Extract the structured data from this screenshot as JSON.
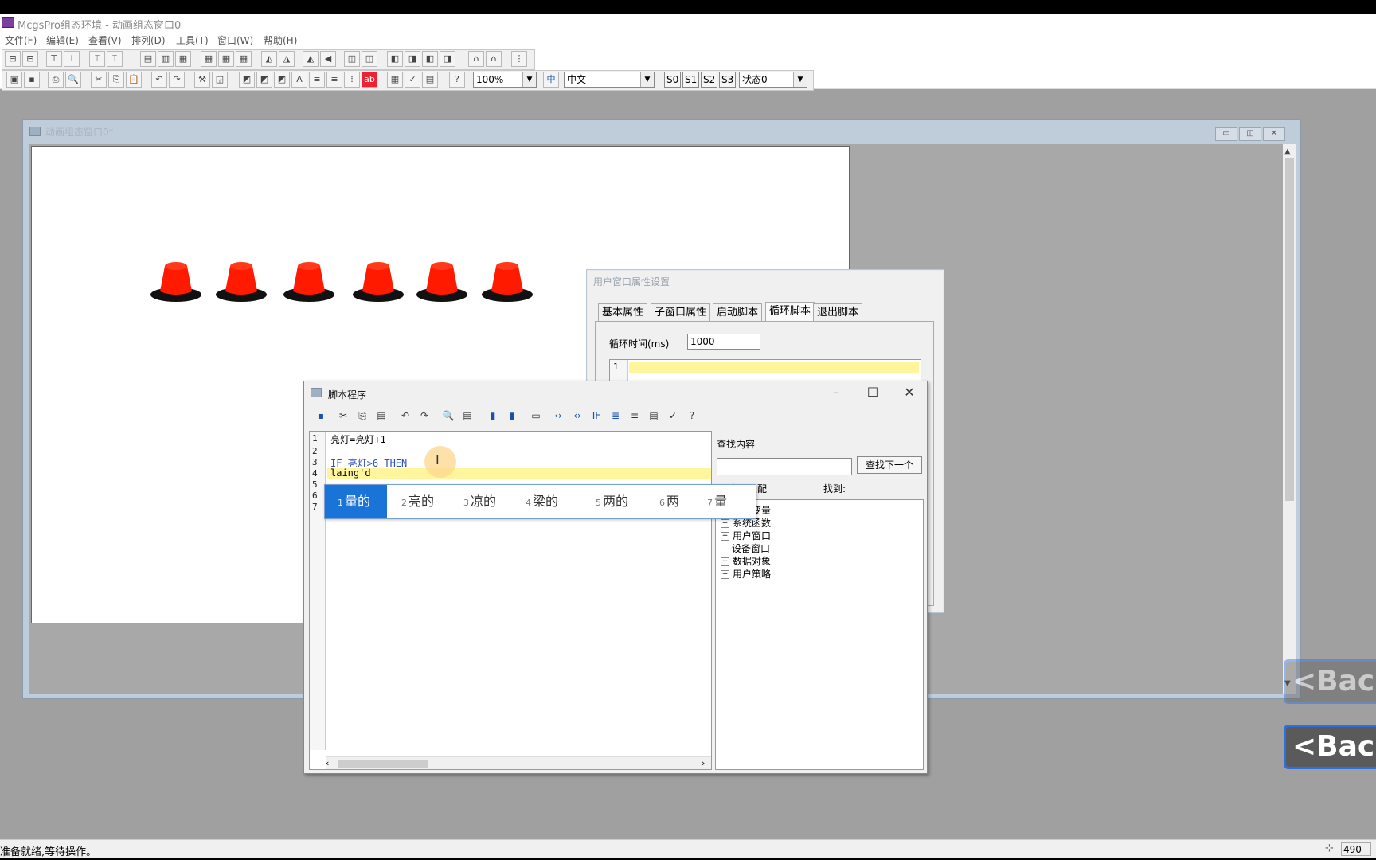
{
  "app": {
    "title": "McgsPro组态环境 - 动画组态窗口0",
    "menu": [
      "文件(F)",
      "编辑(E)",
      "查看(V)",
      "排列(D)",
      "工具(T)",
      "窗口(W)",
      "帮助(H)"
    ],
    "zoom": "100%",
    "language": "中文",
    "state_buttons": [
      "S0",
      "S1",
      "S2",
      "S3"
    ],
    "state_select": "状态0",
    "status_text": "准备就绪,等待操作。",
    "status_value": "490"
  },
  "child_window": {
    "title": "动画组态窗口0*",
    "lamp_color": "#ff1a00",
    "lamp_count": 6
  },
  "prop_dialog": {
    "title": "用户窗口属性设置",
    "tabs": [
      "基本属性",
      "子窗口属性",
      "启动脚本",
      "循环脚本",
      "退出脚本"
    ],
    "active_tab": "循环脚本",
    "cycle_label": "循环时间(ms)",
    "cycle_value": "1000",
    "line_number": "1"
  },
  "script_editor": {
    "title": "脚本程序",
    "lines": [
      {
        "n": "1",
        "text": "亮灯=亮灯+1"
      },
      {
        "n": "2",
        "text": ""
      },
      {
        "n": "3",
        "text": "IF 亮灯>6 THEN"
      },
      {
        "n": "4",
        "text": "laing'd"
      },
      {
        "n": "5",
        "text": ""
      },
      {
        "n": "6",
        "text": ""
      },
      {
        "n": "7",
        "text": ""
      }
    ],
    "find_label": "查找内容",
    "find_next_button": "查找下一个",
    "match_label": "全词匹配",
    "found_label": "找到:",
    "tree": [
      "系统变量",
      "系统函数",
      "用户窗口",
      "设备窗口",
      "数据对象",
      "用户策略"
    ]
  },
  "ime": {
    "candidates": [
      {
        "num": "1",
        "text": "量的"
      },
      {
        "num": "2",
        "text": "亮的"
      },
      {
        "num": "3",
        "text": "凉的"
      },
      {
        "num": "4",
        "text": "梁的"
      },
      {
        "num": "5",
        "text": "两的"
      },
      {
        "num": "6",
        "text": "两"
      },
      {
        "num": "7",
        "text": "量"
      }
    ],
    "selected_index": 0
  },
  "overlay": {
    "back_label": "<Back"
  }
}
